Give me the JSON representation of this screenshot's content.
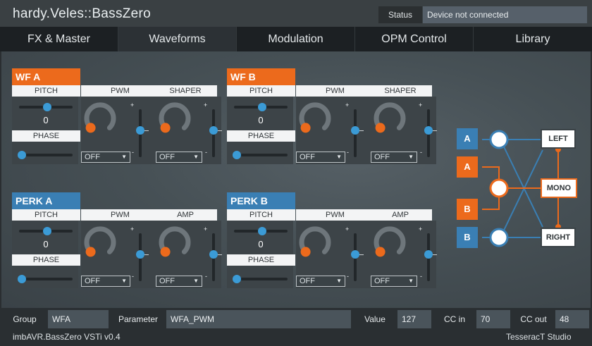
{
  "app": {
    "title": "hardy.Veles::BassZero"
  },
  "status": {
    "label": "Status",
    "value": "Device not connected"
  },
  "tabs": [
    "FX & Master",
    "Waveforms",
    "Modulation",
    "OPM Control",
    "Library"
  ],
  "panels": {
    "wfa": {
      "title": "WF A",
      "pitch": "PITCH",
      "pwm": "PWM",
      "third": "SHAPER",
      "phase": "PHASE",
      "value": "0",
      "dd1": "OFF",
      "dd2": "OFF"
    },
    "wfb": {
      "title": "WF B",
      "pitch": "PITCH",
      "pwm": "PWM",
      "third": "SHAPER",
      "phase": "PHASE",
      "value": "0",
      "dd1": "OFF",
      "dd2": "OFF"
    },
    "perka": {
      "title": "PERK A",
      "pitch": "PITCH",
      "pwm": "PWM",
      "third": "AMP",
      "phase": "PHASE",
      "value": "0",
      "dd1": "OFF",
      "dd2": "OFF"
    },
    "perkb": {
      "title": "PERK B",
      "pitch": "PITCH",
      "pwm": "PWM",
      "third": "AMP",
      "phase": "PHASE",
      "value": "0",
      "dd1": "OFF",
      "dd2": "OFF"
    }
  },
  "routing": {
    "a1": "A",
    "a2": "A",
    "b1": "B",
    "b2": "B",
    "left": "LEFT",
    "mono": "MONO",
    "right": "RIGHT"
  },
  "bottom": {
    "group_label": "Group",
    "group_value": "WFA",
    "param_label": "Parameter",
    "param_value": "WFA_PWM",
    "value_label": "Value",
    "value": "127",
    "ccin_label": "CC in",
    "ccin": "70",
    "ccout_label": "CC out",
    "ccout": "48"
  },
  "footer": {
    "version": "imbAVR.BassZero VSTi v0.4",
    "studio": "TesseracT Studio"
  },
  "colors": {
    "orange": "#ec6a1c",
    "blue": "#3a7fb4",
    "slider": "#3b9bd6"
  }
}
